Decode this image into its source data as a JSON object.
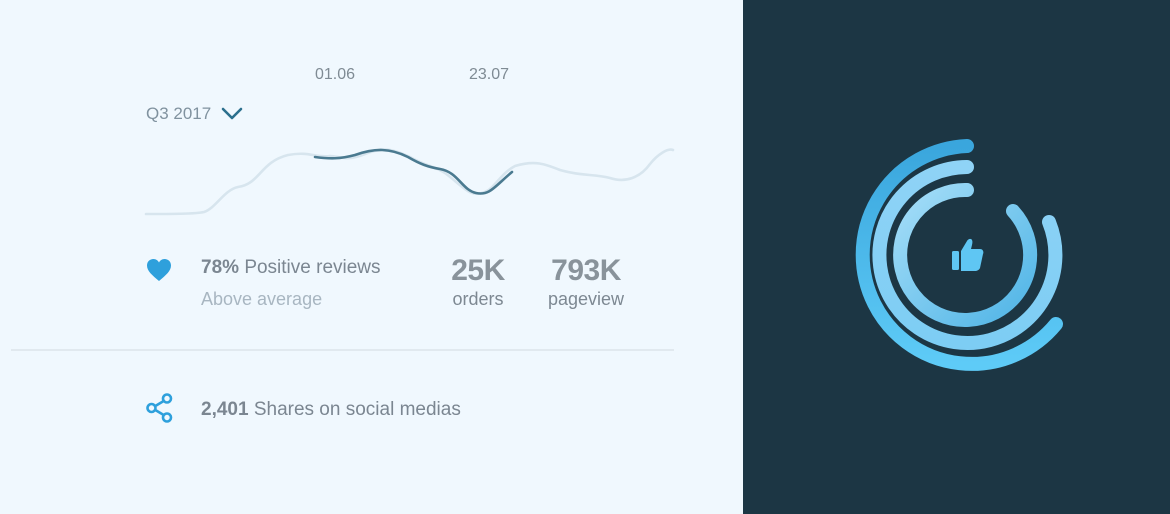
{
  "chart": {
    "dates": [
      "01.06",
      "23.07"
    ],
    "period": "Q3 2017",
    "highlight_color": "#4a7a90",
    "base_color": "#d7e5ee"
  },
  "stats": {
    "reviews_value": "78%",
    "reviews_label": "Positive reviews",
    "reviews_sub": "Above average",
    "orders_value": "25K",
    "orders_label": "orders",
    "pageview_value": "793K",
    "pageview_label": "pageview"
  },
  "social": {
    "shares_value": "2,401",
    "shares_label": "Shares on social medias"
  },
  "icons": {
    "heart": "heart-icon",
    "share": "share-icon",
    "chevron": "chevron-down-icon",
    "thumbs": "thumbs-up-icon"
  },
  "colors": {
    "accent": "#2ea0dc",
    "panel_dark": "#1c3644",
    "ring_light": "#9bd9f6",
    "ring_mid": "#5fc1ef"
  }
}
